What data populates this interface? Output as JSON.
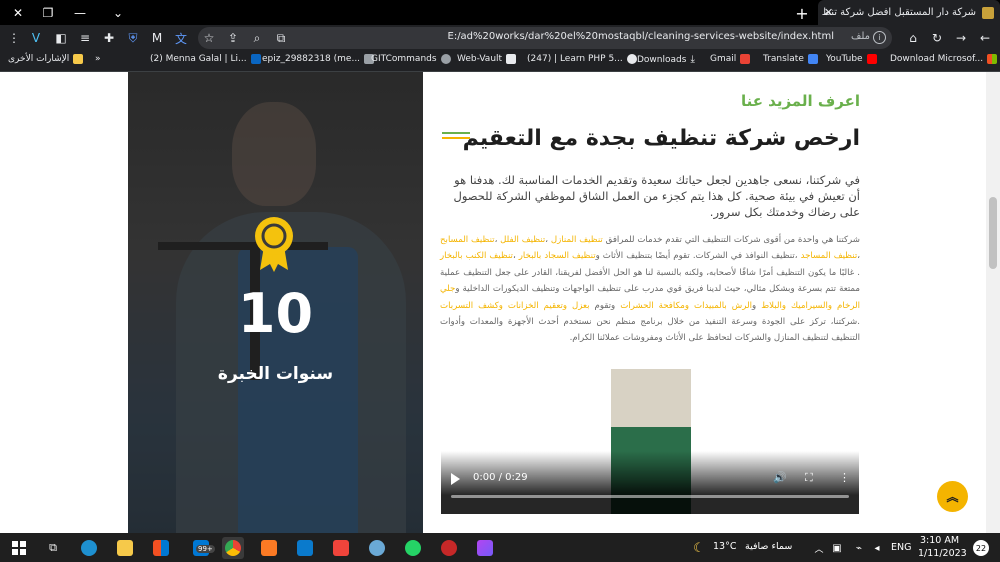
{
  "browser": {
    "tab_title": "شركة دار المستقبل افضل شركة تنظ",
    "url": "E:/ad%20works/dar%20el%20mostaqbl/cleaning-services-website/index.html",
    "url_label": "ملف",
    "new_tab": "+",
    "close_tab": "✕"
  },
  "bookmarks": {
    "other": "الإشارات الأخرى",
    "overflow": "»",
    "items": [
      "(2) Menna Galal | Li...",
      "epiz_29882318 (me...",
      "GITCommands",
      "Web-Vault",
      "(247) | Learn PHP 5...",
      "Downloads",
      "Gmail",
      "Translate",
      "YouTube",
      "Download Microsof..."
    ]
  },
  "hero": {
    "years": "10",
    "years_label": "سنوات الخبرة"
  },
  "about": {
    "kicker": "اعرف المزيد عنا",
    "title": "ارخص شركة تنظيف بجدة مع التعقيم",
    "lead": "في شركتنا، نسعى جاهدين لجعل حياتك سعيدة وتقديم الخدمات المناسبة لك. هدفنا هو أن تعيش في بيئة صحية. كل هذا يتم كجزء من العمل الشاق لموظفي الشركة للحصول على رضاك وخدمتك بكل سرور.",
    "body": [
      "شركتنا هي واحدة من أقوى شركات التنظيف التي تقدم خدمات للمرافق ",
      "تنظيف المنازل",
      " ،",
      "تنظيف الفلل",
      " ،",
      "تنظيف المسابح",
      " ،",
      "تنظيف المساجد",
      " ،تنظيف النوافذ في الشركات. تقوم أيضًا بتنظيف الأثاث و",
      "تنظيف السجاد بالبخار",
      " ،",
      "تنظيف الكنب بالبخار",
      " . غالبًا ما يكون التنظيف أمرًا شاقًا لأصحابه، ولكنه بالنسبة لنا هو الحل الأفضل لفريقنا، القادر على جعل التنظيف عملية ممتعة تتم بسرعة وبشكل مثالي، حيث لدينا فريق قوي مدرب على تنظيف الواجهات وتنظيف الديكورات الداخلية و",
      "جلي الرخام والسيراميك والبلاط",
      " و",
      "الرش بالمبيدات ومكافحة الحشرات",
      " وتقوم ",
      "بعزل وتعقيم الخزانات وكشف التسربات",
      " .شركتنا، تركز على الجودة وسرعة التنفيذ من خلال برنامج منظم نحن نستخدم أحدث الأجهزة والمعدات وأدوات التنظيف لتنظيف المنازل والشركات لتحافظ على الأثاث ومفروشات عملائنا الكرام."
    ]
  },
  "video": {
    "time": "0:00 / 0:29"
  },
  "taskbar": {
    "badge": "99+",
    "temperature": "13°C",
    "weather": "سماء صافية",
    "lang": "ENG",
    "time": "3:10 AM",
    "date": "1/11/2023",
    "notif": "22"
  },
  "colors": {
    "accent_green": "#6ab04c",
    "accent_yellow": "#f4b400"
  }
}
